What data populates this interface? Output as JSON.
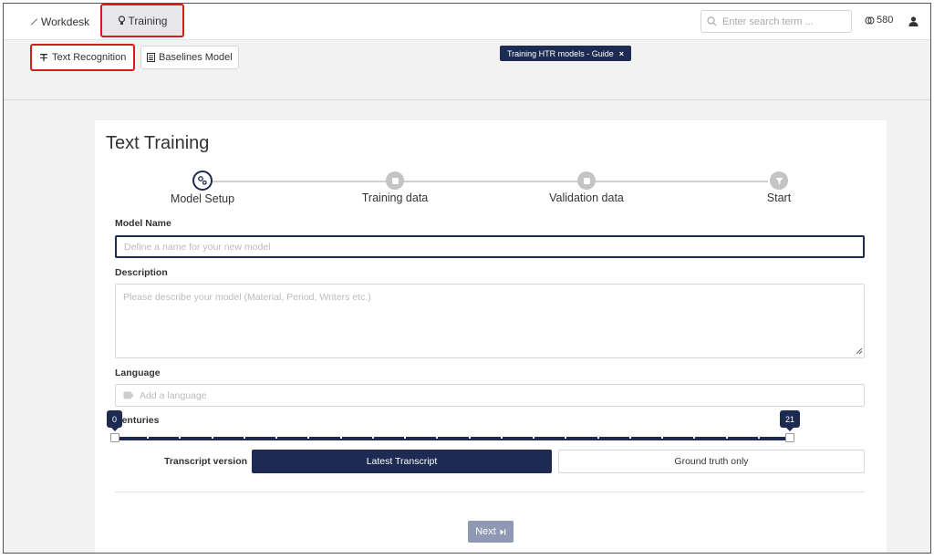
{
  "nav": {
    "workdesk_label": "Workdesk",
    "training_label": "Training",
    "search_placeholder": "Enter search term ...",
    "credits": "580"
  },
  "subnav": {
    "text_recognition_label": "Text Recognition",
    "baselines_label": "Baselines Model",
    "guide_tag_label": "Training HTR models - Guide",
    "guide_close": "×"
  },
  "card": {
    "title": "Text Training",
    "steps": [
      {
        "label": "Model Setup",
        "active": true
      },
      {
        "label": "Training data",
        "active": false
      },
      {
        "label": "Validation data",
        "active": false
      },
      {
        "label": "Start",
        "active": false
      }
    ],
    "model_name_label": "Model Name",
    "model_name_placeholder": "Define a name for your new model",
    "description_label": "Description",
    "description_placeholder": "Please describe your model (Material, Period, Writers etc.)",
    "language_label": "Language",
    "language_placeholder": "Add a language",
    "centuries_label": "Centuries",
    "centuries_min": "0",
    "centuries_max": "21",
    "transcript_label": "Transcript version",
    "transcript_options": [
      "Latest Transcript",
      "Ground truth only"
    ],
    "next_label": "Next"
  },
  "colors": {
    "primary": "#1d2b53",
    "highlight": "#d81b1b",
    "disabled": "#8f99b3"
  }
}
